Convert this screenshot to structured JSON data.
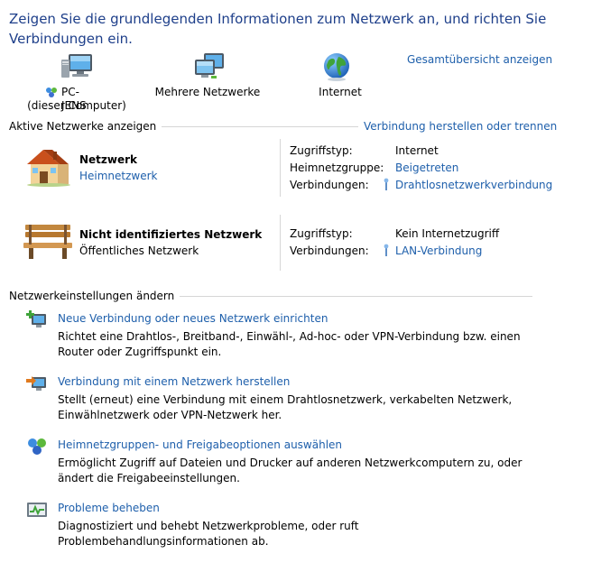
{
  "title": "Zeigen Sie die grundlegenden Informationen zum Netzwerk an, und richten Sie Verbindungen ein.",
  "overview_link": "Gesamtübersicht anzeigen",
  "map": {
    "computer_name": "PC-JENS",
    "computer_sub": "(dieser Computer)",
    "network_label": "Mehrere Netzwerke",
    "internet_label": "Internet"
  },
  "active": {
    "heading": "Aktive Netzwerke anzeigen",
    "connect_link": "Verbindung herstellen oder trennen",
    "networks": [
      {
        "name": "Netzwerk",
        "type": "Heimnetzwerk",
        "rows": [
          {
            "key": "Zugriffstyp:",
            "value": "Internet"
          },
          {
            "key": "Heimnetzgruppe:",
            "value": "Beigetreten"
          },
          {
            "key": "Verbindungen:",
            "value": "Drahtlosnetzwerkverbindung"
          }
        ]
      },
      {
        "name": "Nicht identifiziertes Netzwerk",
        "type": "Öffentliches Netzwerk",
        "rows": [
          {
            "key": "Zugriffstyp:",
            "value": "Kein Internetzugriff"
          },
          {
            "key": "Verbindungen:",
            "value": "LAN-Verbindung"
          }
        ]
      }
    ]
  },
  "settings": {
    "heading": "Netzwerkeinstellungen ändern",
    "tasks": [
      {
        "title": "Neue Verbindung oder neues Netzwerk einrichten",
        "desc": "Richtet eine Drahtlos-, Breitband-, Einwähl-, Ad-hoc- oder VPN-Verbindung bzw. einen Router oder Zugriffspunkt ein."
      },
      {
        "title": "Verbindung mit einem Netzwerk herstellen",
        "desc": "Stellt (erneut) eine Verbindung mit einem Drahtlosnetzwerk, verkabelten Netzwerk, Einwählnetzwerk oder VPN-Netzwerk her."
      },
      {
        "title": "Heimnetzgruppen- und Freigabeoptionen auswählen",
        "desc": "Ermöglicht Zugriff auf Dateien und Drucker auf anderen Netzwerkcomputern zu, oder ändert die Freigabeeinstellungen."
      },
      {
        "title": "Probleme beheben",
        "desc": "Diagnostiziert und behebt Netzwerkprobleme, oder ruft Problembehandlungsinformationen ab."
      }
    ]
  },
  "colors": {
    "link": "#1e5fab",
    "title": "#1e3f8a",
    "rule": "#d6d6d6"
  }
}
